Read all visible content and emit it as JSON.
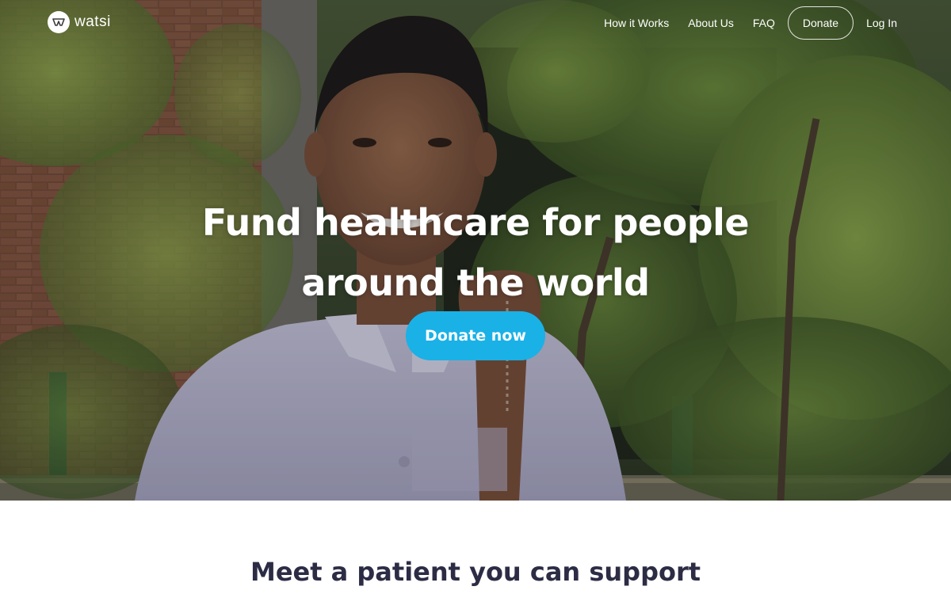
{
  "brand": {
    "name": "watsi"
  },
  "nav": {
    "items": [
      {
        "label": "How it Works"
      },
      {
        "label": "About Us"
      },
      {
        "label": "FAQ"
      },
      {
        "label": "Donate"
      },
      {
        "label": "Log In"
      }
    ]
  },
  "hero": {
    "headline_line1": "Fund healthcare for people",
    "headline_line2": "around the world",
    "cta_label": "Donate now"
  },
  "section": {
    "title": "Meet a patient you can support"
  },
  "colors": {
    "accent": "#1ab1e7",
    "heading_dark": "#2c2c45"
  },
  "icons": {
    "logo": "watsi-logo-icon"
  }
}
